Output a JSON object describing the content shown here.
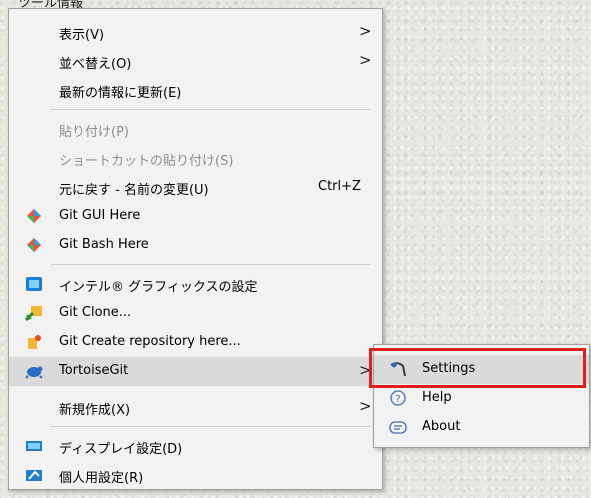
{
  "top_label": "ツール情報",
  "menu": {
    "items": [
      {
        "label": "表示(V)",
        "arrow": ">"
      },
      {
        "label": "並べ替え(O)",
        "arrow": ">"
      },
      {
        "label": "最新の情報に更新(E)"
      },
      {
        "label": "貼り付け(P)"
      },
      {
        "label": "ショートカットの貼り付け(S)"
      },
      {
        "label": "元に戻す - 名前の変更(U)",
        "shortcut": "Ctrl+Z"
      },
      {
        "label": "Git GUI Here",
        "icon": "git-diamond-icon"
      },
      {
        "label": "Git Bash Here",
        "icon": "git-diamond-icon"
      },
      {
        "label": "インテル® グラフィックスの設定",
        "icon": "intel-graphics-icon"
      },
      {
        "label": "Git Clone...",
        "icon": "git-clone-icon"
      },
      {
        "label": "Git Create repository here...",
        "icon": "git-create-repo-icon"
      },
      {
        "label": "TortoiseGit",
        "icon": "tortoisegit-icon",
        "arrow": ">"
      },
      {
        "label": "新規作成(X)",
        "arrow": ">"
      },
      {
        "label": "ディスプレイ設定(D)",
        "icon": "display-icon"
      },
      {
        "label": "個人用設定(R)",
        "icon": "personalize-icon"
      }
    ]
  },
  "submenu": {
    "items": [
      {
        "label": "Settings",
        "icon": "tortoisegit-settings-icon"
      },
      {
        "label": "Help",
        "icon": "help-icon"
      },
      {
        "label": "About",
        "icon": "about-icon"
      }
    ]
  },
  "colors": {
    "menu_bg": "#f2f2f2",
    "hover_bg": "#dadada",
    "highlight_border": "#e01e1e",
    "disabled_text": "#8d8d8d"
  }
}
